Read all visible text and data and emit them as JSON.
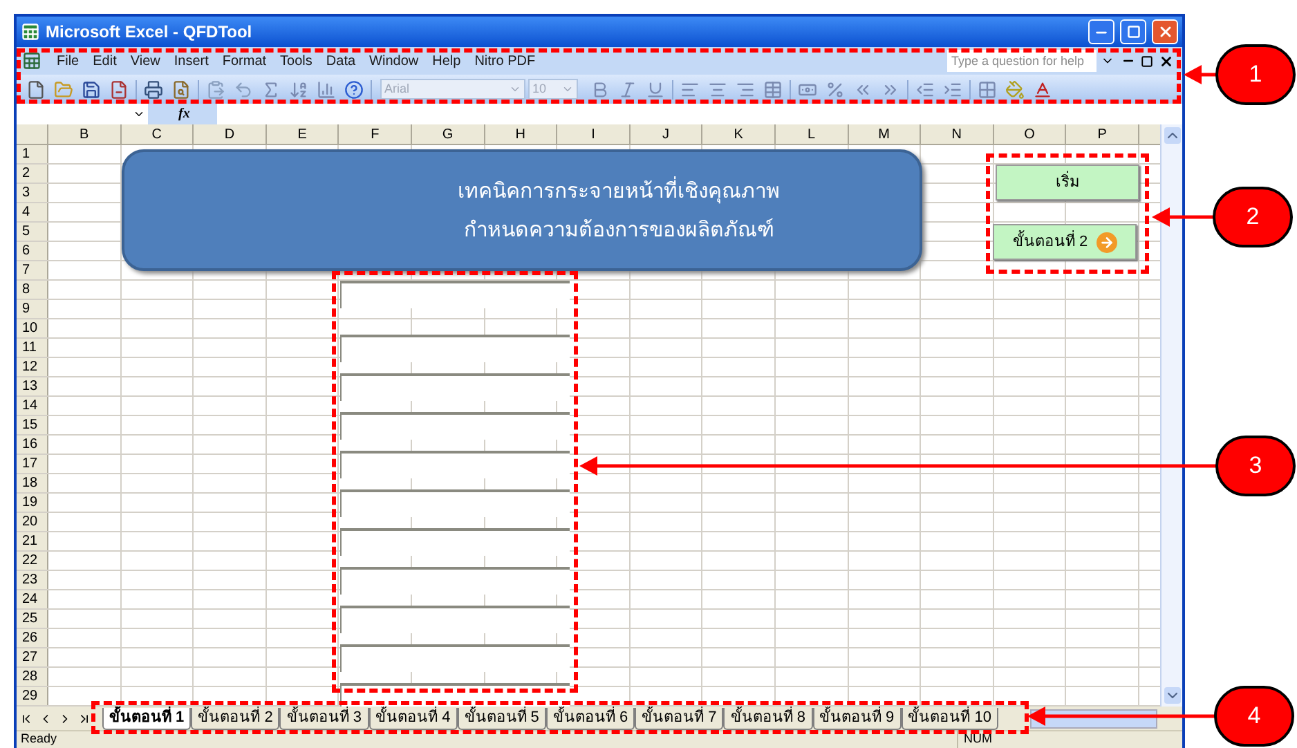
{
  "window": {
    "title": "Microsoft Excel - QFDTool"
  },
  "menu_bar": {
    "items": [
      "File",
      "Edit",
      "View",
      "Insert",
      "Format",
      "Tools",
      "Data",
      "Window",
      "Help",
      "Nitro PDF"
    ],
    "help_box": {
      "placeholder": "Type a question for help"
    }
  },
  "toolbar": {
    "font": {
      "value": "Arial",
      "disabled": true
    },
    "font_size": {
      "value": "10",
      "disabled": true
    }
  },
  "formula_bar": {
    "fx_label": "fx"
  },
  "sheet": {
    "columns": [
      "B",
      "C",
      "D",
      "E",
      "F",
      "G",
      "H",
      "I",
      "J",
      "K",
      "L",
      "M",
      "N",
      "O",
      "P"
    ],
    "rows": [
      "1",
      "2",
      "3",
      "4",
      "5",
      "6",
      "7",
      "8",
      "9",
      "10",
      "11",
      "12",
      "13",
      "14",
      "15",
      "16",
      "17",
      "18",
      "19",
      "20",
      "21",
      "22",
      "23",
      "24",
      "25",
      "26",
      "27",
      "28",
      "29"
    ],
    "banner": {
      "lines": [
        "เทคนิคการกระจายหน้าที่เชิงคุณภาพ",
        "กำหนดความต้องการของผลิตภัณฑ์"
      ]
    },
    "buttons": [
      {
        "label": "เริ่ม",
        "kind": "plain"
      },
      {
        "label": "ขั้นตอนที่ 2",
        "kind": "next"
      }
    ]
  },
  "sheet_tabs": [
    {
      "label": "ขั้นตอนที่ 1",
      "selected": true
    },
    {
      "label": "ขั้นตอนที่ 2",
      "selected": false
    },
    {
      "label": "ขั้นตอนที่ 3",
      "selected": false
    },
    {
      "label": "ขั้นตอนที่ 4",
      "selected": false
    },
    {
      "label": "ขั้นตอนที่ 5",
      "selected": false
    },
    {
      "label": "ขั้นตอนที่ 6",
      "selected": false
    },
    {
      "label": "ขั้นตอนที่ 7",
      "selected": false
    },
    {
      "label": "ขั้นตอนที่ 8",
      "selected": false
    },
    {
      "label": "ขั้นตอนที่ 9",
      "selected": false
    },
    {
      "label": "ขั้นตอนที่ 10",
      "selected": false
    }
  ],
  "status_bar": {
    "message": "Ready",
    "indicators": [
      "NUM"
    ]
  },
  "annotations": [
    {
      "label": "1"
    },
    {
      "label": "2"
    },
    {
      "label": "3"
    },
    {
      "label": "4"
    }
  ]
}
